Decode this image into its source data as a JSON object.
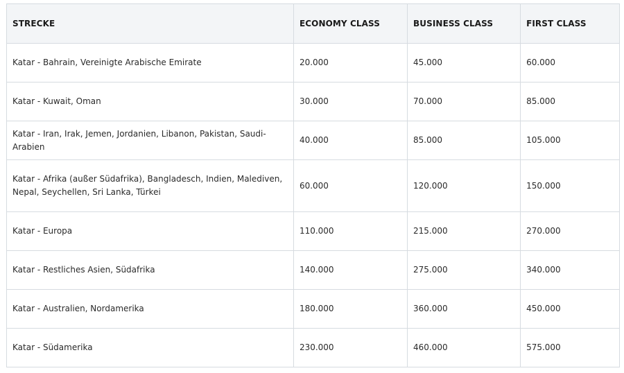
{
  "table": {
    "headers": {
      "route": "STRECKE",
      "economy": "ECONOMY CLASS",
      "business": "BUSINESS CLASS",
      "first": "FIRST CLASS"
    },
    "rows": [
      {
        "route": "Katar - Bahrain, Vereinigte Arabische Emirate",
        "economy": "20.000",
        "business": "45.000",
        "first": "60.000"
      },
      {
        "route": "Katar - Kuwait, Oman",
        "economy": "30.000",
        "business": "70.000",
        "first": "85.000"
      },
      {
        "route": "Katar - Iran, Irak, Jemen, Jordanien, Libanon, Pakistan, Saudi-Arabien",
        "economy": "40.000",
        "business": "85.000",
        "first": "105.000"
      },
      {
        "route": "Katar - Afrika (außer Südafrika), Bangladesch, Indien, Malediven, Nepal, Seychellen, Sri Lanka, Türkei",
        "economy": "60.000",
        "business": "120.000",
        "first": "150.000"
      },
      {
        "route": "Katar - Europa",
        "economy": "110.000",
        "business": "215.000",
        "first": "270.000"
      },
      {
        "route": "Katar - Restliches Asien, Südafrika",
        "economy": "140.000",
        "business": "275.000",
        "first": "340.000"
      },
      {
        "route": "Katar - Australien, Nordamerika",
        "economy": "180.000",
        "business": "360.000",
        "first": "450.000"
      },
      {
        "route": "Katar - Südamerika",
        "economy": "230.000",
        "business": "460.000",
        "first": "575.000"
      }
    ]
  }
}
